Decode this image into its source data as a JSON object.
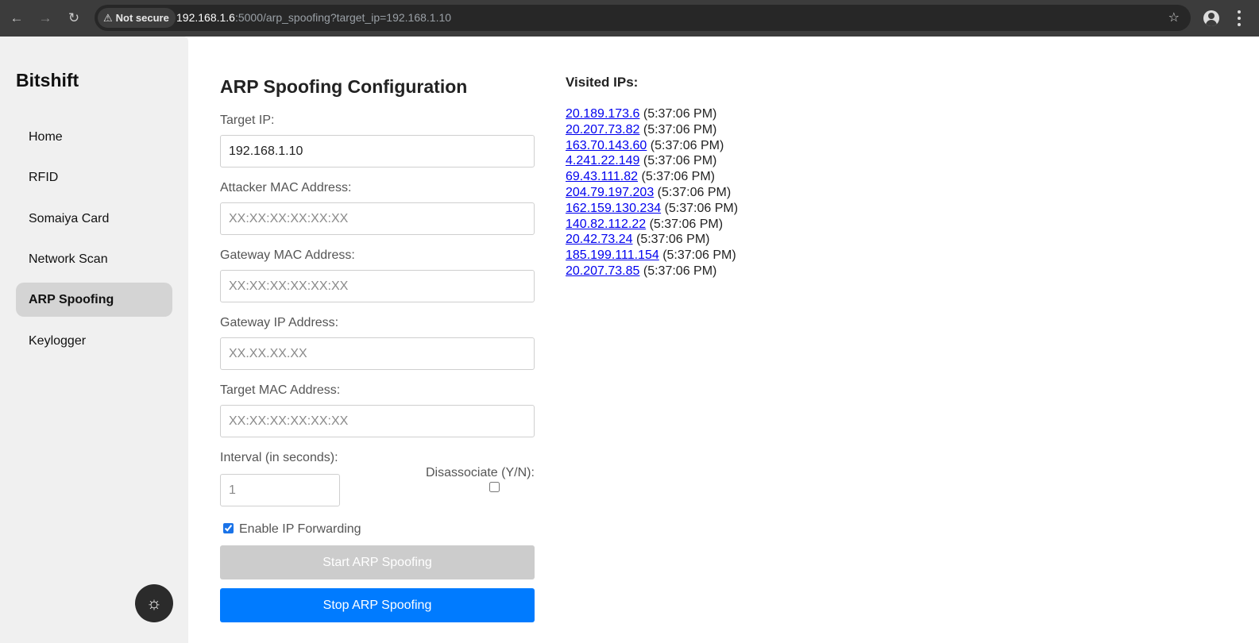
{
  "browser": {
    "security_label": "Not secure",
    "url_host": "192.168.1.6",
    "url_rest": ":5000/arp_spoofing?target_ip=192.168.1.10",
    "icons": [
      "back-icon",
      "forward-icon",
      "reload-icon",
      "warning-icon",
      "star-icon",
      "profile-icon",
      "menu-icon"
    ]
  },
  "sidebar": {
    "brand": "Bitshift",
    "items": [
      {
        "label": "Home"
      },
      {
        "label": "RFID"
      },
      {
        "label": "Somaiya Card"
      },
      {
        "label": "Network Scan"
      },
      {
        "label": "ARP Spoofing",
        "active": true
      },
      {
        "label": "Keylogger"
      }
    ],
    "theme_icon": "sun-icon"
  },
  "form": {
    "title": "ARP Spoofing Configuration",
    "target_ip": {
      "label": "Target IP:",
      "value": "192.168.1.10"
    },
    "attacker_mac": {
      "label": "Attacker MAC Address:",
      "placeholder": "XX:XX:XX:XX:XX:XX"
    },
    "gateway_mac": {
      "label": "Gateway MAC Address:",
      "placeholder": "XX:XX:XX:XX:XX:XX"
    },
    "gateway_ip": {
      "label": "Gateway IP Address:",
      "placeholder": "XX.XX.XX.XX"
    },
    "target_mac": {
      "label": "Target MAC Address:",
      "placeholder": "XX:XX:XX:XX:XX:XX"
    },
    "interval": {
      "label": "Interval (in seconds):",
      "placeholder": "1"
    },
    "disassociate": {
      "label": "Disassociate (Y/N):",
      "checked": false
    },
    "ip_forwarding": {
      "label": "Enable IP Forwarding",
      "checked": true
    },
    "start_label": "Start ARP Spoofing",
    "stop_label": "Stop ARP Spoofing"
  },
  "visited": {
    "title": "Visited IPs:",
    "items": [
      {
        "ip": "20.189.173.6",
        "time": "(5:37:06 PM)"
      },
      {
        "ip": "20.207.73.82",
        "time": "(5:37:06 PM)"
      },
      {
        "ip": "163.70.143.60",
        "time": "(5:37:06 PM)"
      },
      {
        "ip": "4.241.22.149",
        "time": "(5:37:06 PM)"
      },
      {
        "ip": "69.43.111.82",
        "time": "(5:37:06 PM)"
      },
      {
        "ip": "204.79.197.203",
        "time": "(5:37:06 PM)"
      },
      {
        "ip": "162.159.130.234",
        "time": "(5:37:06 PM)"
      },
      {
        "ip": "140.82.112.22",
        "time": "(5:37:06 PM)"
      },
      {
        "ip": "20.42.73.24",
        "time": "(5:37:06 PM)"
      },
      {
        "ip": "185.199.111.154",
        "time": "(5:37:06 PM)"
      },
      {
        "ip": "20.207.73.85",
        "time": "(5:37:06 PM)"
      }
    ]
  },
  "colors": {
    "primary_button": "#007bff",
    "disabled_button": "#cccccc",
    "link": "#0000ee",
    "sidebar_bg": "#f0f0f0",
    "active_nav_bg": "#d4d4d4"
  }
}
